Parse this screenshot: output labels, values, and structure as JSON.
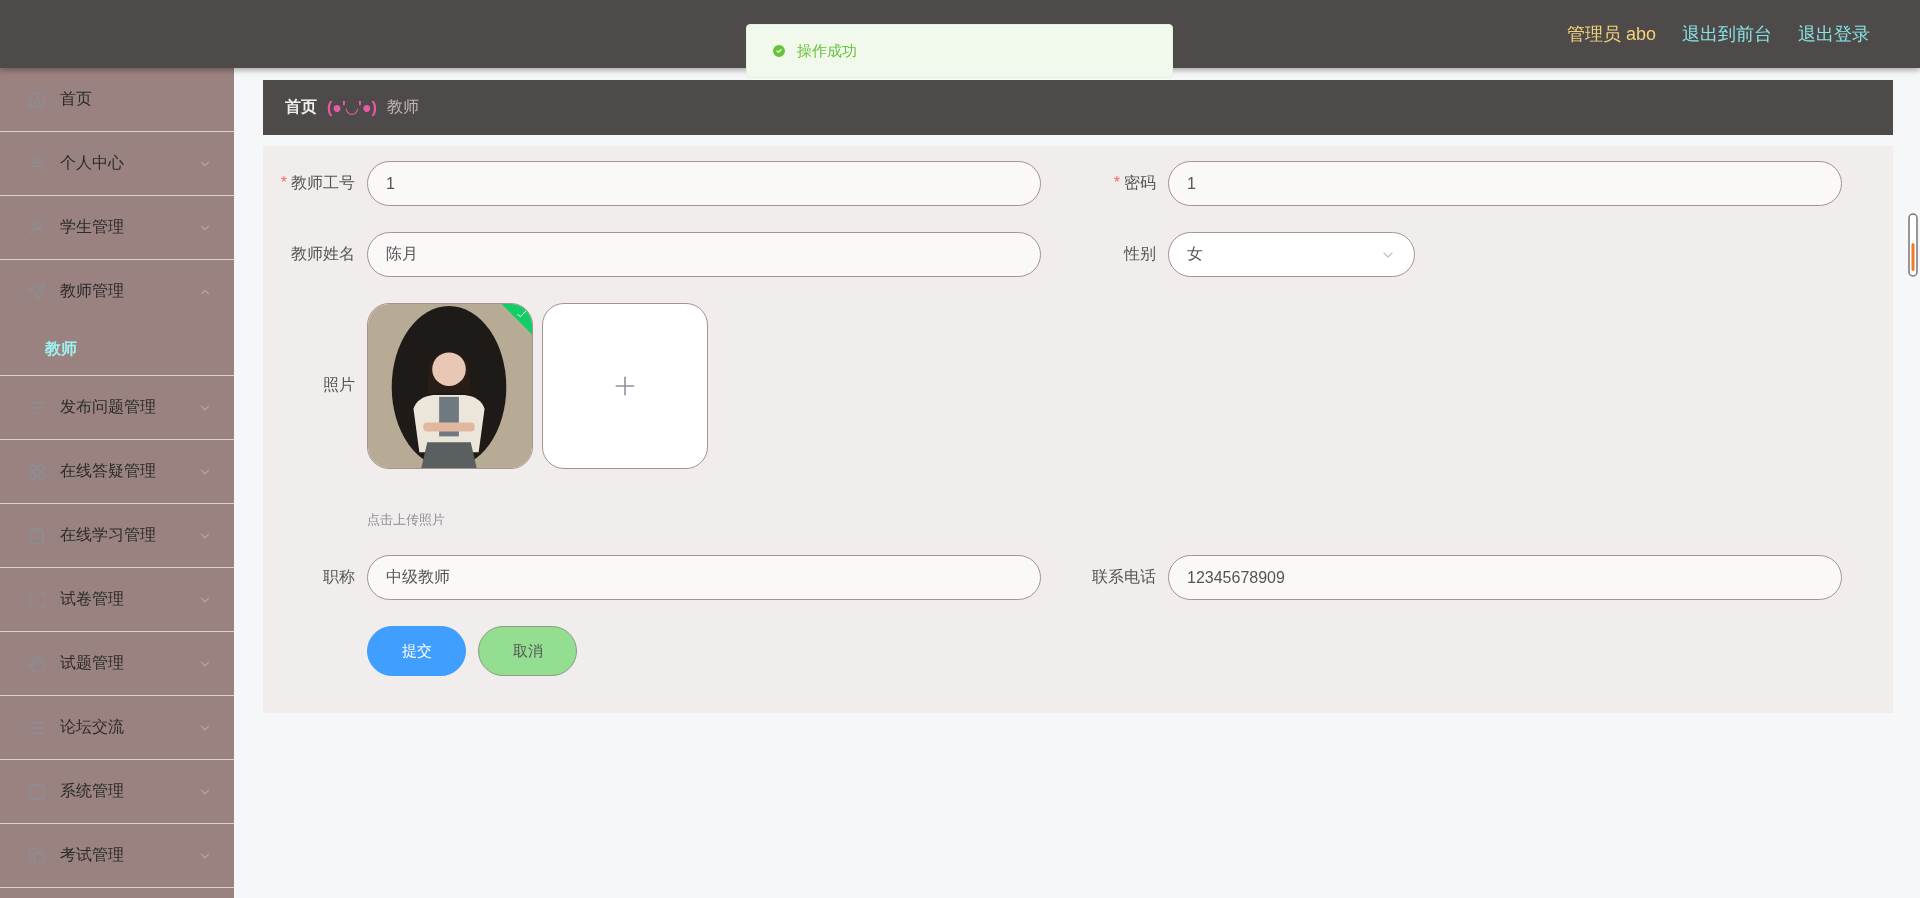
{
  "header": {
    "user": "管理员 abo",
    "links": [
      "退出到前台",
      "退出登录"
    ]
  },
  "toast": {
    "text": "操作成功"
  },
  "sidebar": {
    "items": [
      {
        "kind": "link",
        "label": "首页"
      },
      {
        "kind": "group",
        "label": "个人中心",
        "expanded": false
      },
      {
        "kind": "group",
        "label": "学生管理",
        "expanded": false
      },
      {
        "kind": "group",
        "label": "教师管理",
        "expanded": true,
        "children": [
          {
            "label": "教师",
            "selected": true
          }
        ]
      },
      {
        "kind": "group",
        "label": "发布问题管理",
        "expanded": false
      },
      {
        "kind": "group",
        "label": "在线答疑管理",
        "expanded": false
      },
      {
        "kind": "group",
        "label": "在线学习管理",
        "expanded": false
      },
      {
        "kind": "group",
        "label": "试卷管理",
        "expanded": false
      },
      {
        "kind": "group",
        "label": "试题管理",
        "expanded": false
      },
      {
        "kind": "group",
        "label": "论坛交流",
        "expanded": false
      },
      {
        "kind": "group",
        "label": "系统管理",
        "expanded": false
      },
      {
        "kind": "group",
        "label": "考试管理",
        "expanded": false
      }
    ]
  },
  "breadcrumb": {
    "home": "首页",
    "separator": "(●'◡'●)",
    "current": "教师"
  },
  "form": {
    "fields": [
      {
        "kind": "text",
        "marker": "*",
        "label": "教师工号",
        "value": "1"
      },
      {
        "kind": "text",
        "marker": "*",
        "label": "密码",
        "value": "1"
      },
      {
        "kind": "text",
        "label": "教师姓名",
        "value": "陈月"
      },
      {
        "kind": "select",
        "label": "性别",
        "value": "女"
      },
      {
        "kind": "upload",
        "label": "照片",
        "hint": "点击上传照片",
        "files": [
          {
            "kind": "picture",
            "uploaded": true
          }
        ]
      },
      {
        "kind": "text",
        "label": "职称",
        "value": "中级教师"
      },
      {
        "kind": "text",
        "label": "联系电话",
        "value": "12345678909"
      }
    ],
    "buttons": [
      {
        "kind": "primary",
        "label": "提交"
      },
      {
        "kind": "cancel",
        "label": "取消"
      }
    ]
  }
}
